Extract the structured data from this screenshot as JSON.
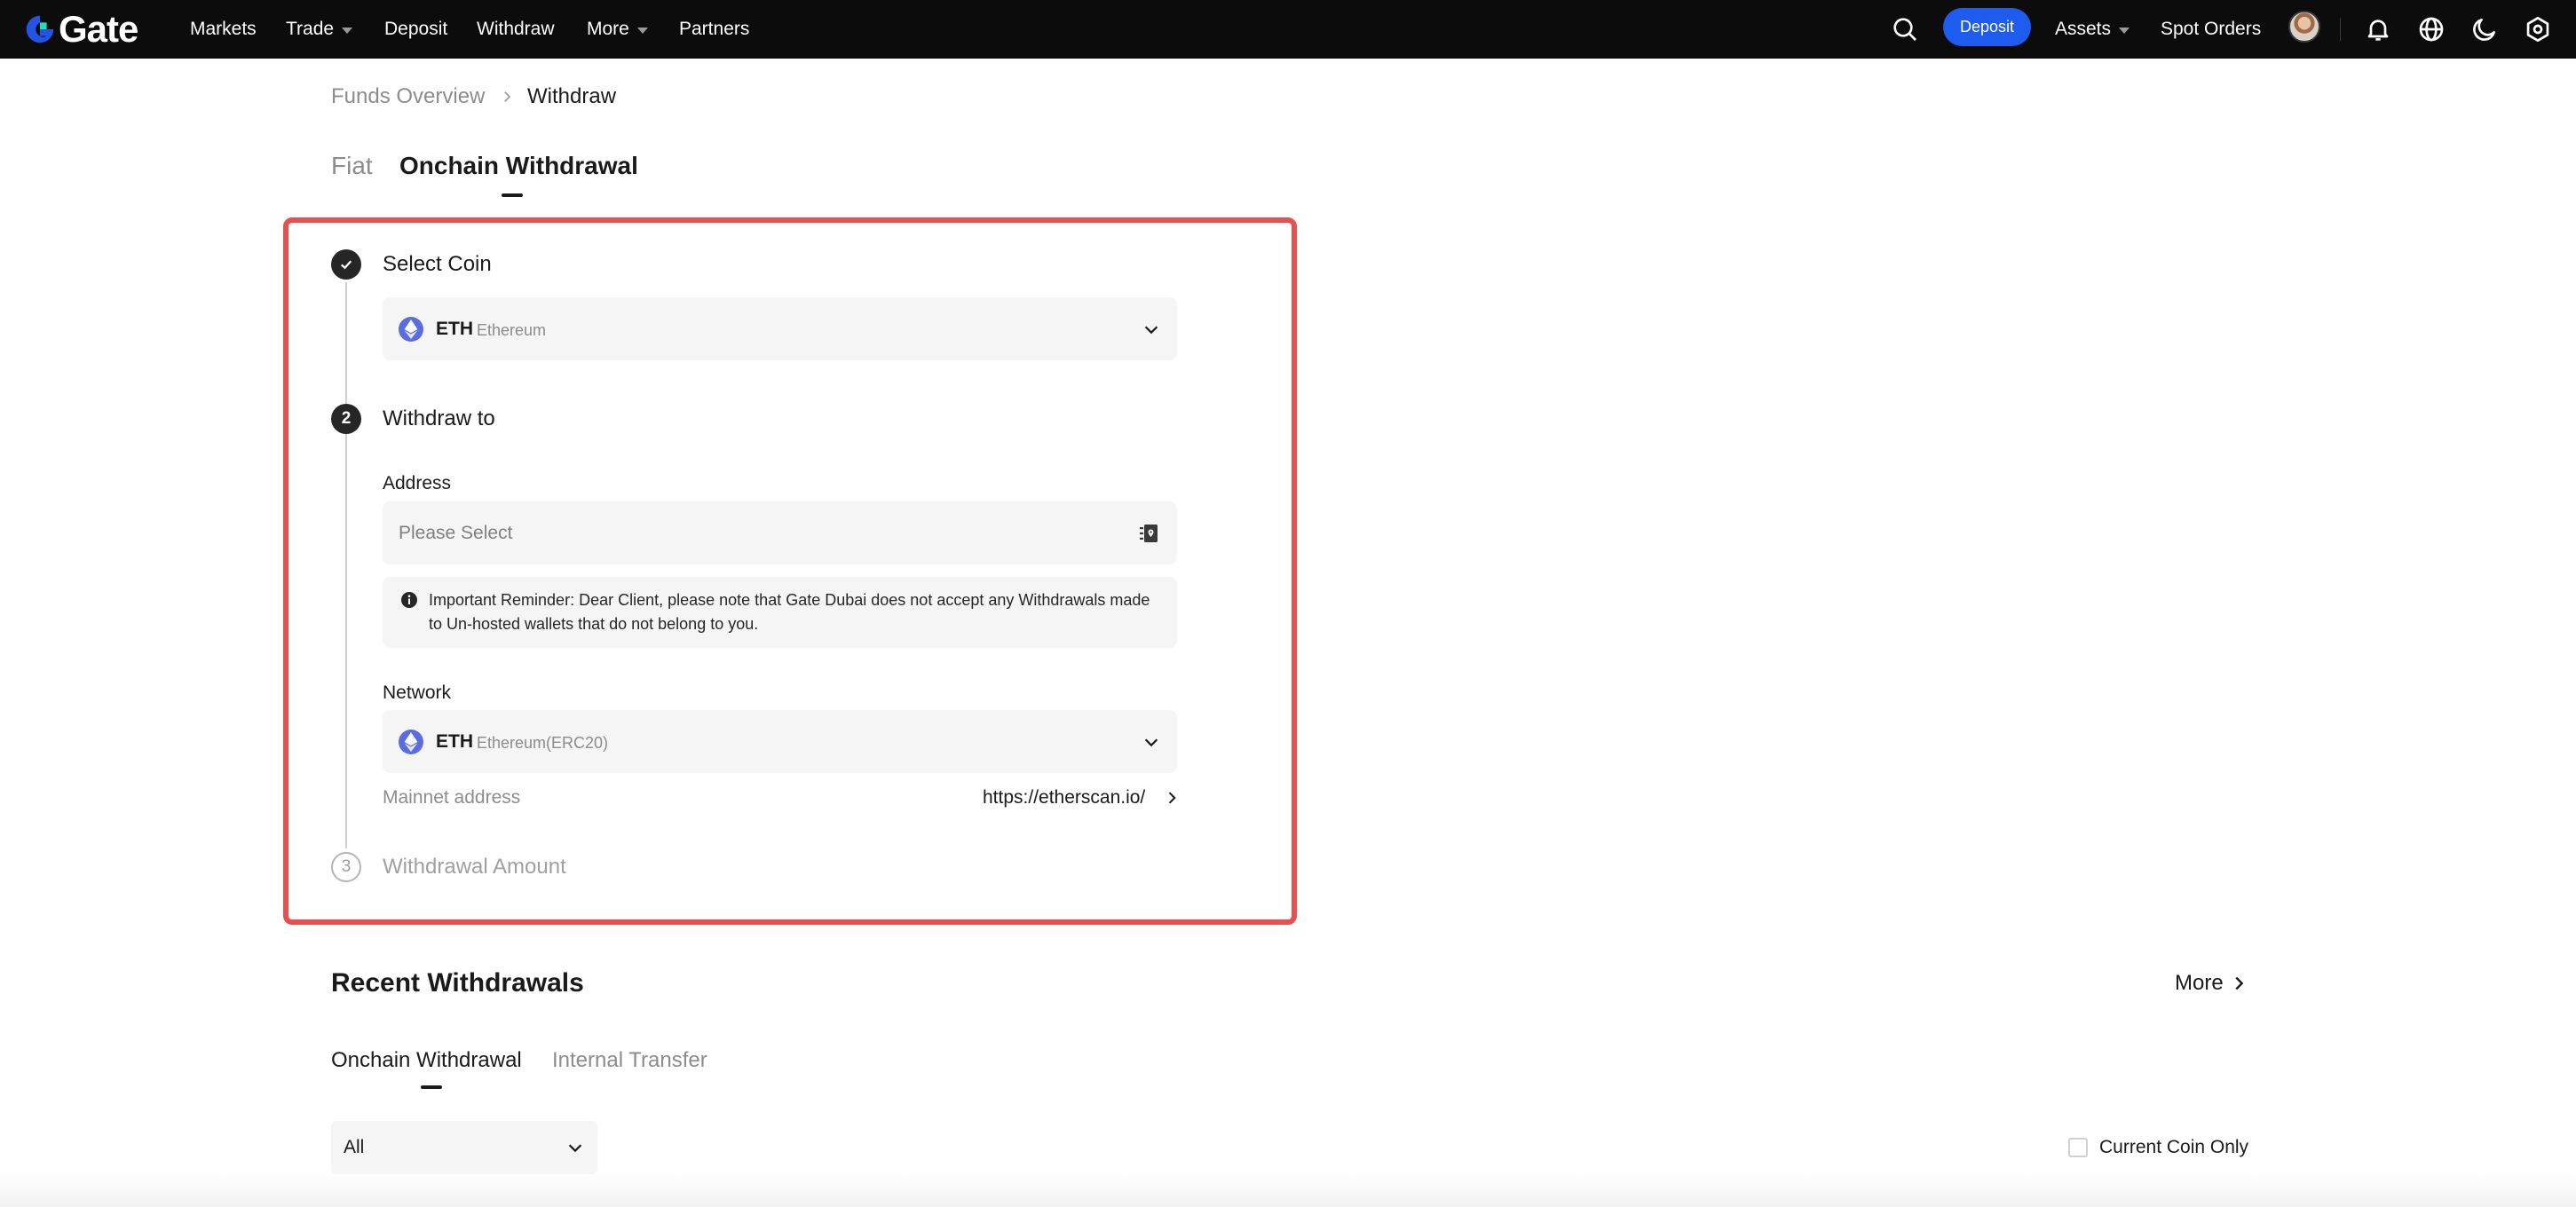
{
  "nav": {
    "brand": "Gate",
    "links": [
      "Markets",
      "Trade",
      "Deposit",
      "Withdraw",
      "More",
      "Partners"
    ],
    "deposit_button": "Deposit",
    "assets": "Assets",
    "spot_orders": "Spot Orders"
  },
  "breadcrumb": {
    "parent": "Funds Overview",
    "current": "Withdraw"
  },
  "tabs": {
    "fiat": "Fiat",
    "onchain": "Onchain Withdrawal"
  },
  "steps": {
    "select_coin": {
      "number": "1",
      "title": "Select Coin",
      "coin_symbol": "ETH",
      "coin_name": "Ethereum"
    },
    "withdraw_to": {
      "number": "2",
      "title": "Withdraw to",
      "address_label": "Address",
      "address_placeholder": "Please Select",
      "reminder": "Important Reminder: Dear Client, please note that Gate Dubai does not accept any Withdrawals made to Un-hosted wallets that do not belong to you.",
      "network_label": "Network",
      "network_symbol": "ETH",
      "network_name": "Ethereum(ERC20)",
      "mainnet_label": "Mainnet address",
      "mainnet_link": "https://etherscan.io/"
    },
    "amount": {
      "number": "3",
      "title": "Withdrawal Amount"
    }
  },
  "recent": {
    "title": "Recent Withdrawals",
    "more": "More",
    "tabs": [
      "Onchain Withdrawal",
      "Internal Transfer"
    ],
    "filter_value": "All",
    "current_coin_only": "Current Coin Only"
  },
  "colors": {
    "accent": "#1e5cf0",
    "highlight_border": "#ea4f4f",
    "eth": "#5a6cde"
  }
}
